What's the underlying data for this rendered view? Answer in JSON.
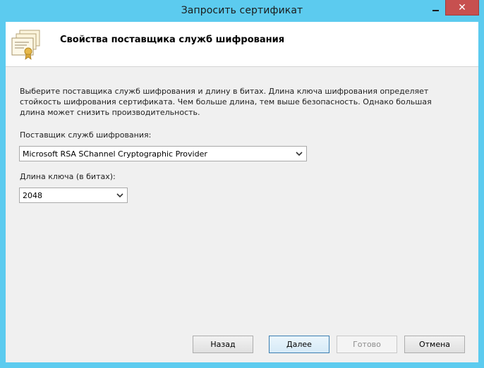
{
  "window": {
    "title": "Запросить сертификат"
  },
  "header": {
    "title": "Свойства поставщика служб шифрования",
    "icon": "certificate-icon"
  },
  "content": {
    "description": "Выберите поставщика служб шифрования и длину в битах. Длина ключа шифрования определяет стойкость шифрования сертификата. Чем больше длина, тем выше безопасность. Однако большая длина может снизить производительность.",
    "provider_label": "Поставщик служб шифрования:",
    "provider_value": "Microsoft RSA SChannel Cryptographic Provider",
    "key_length_label": "Длина ключа (в битах):",
    "key_length_value": "2048"
  },
  "buttons": {
    "back": "Назад",
    "next": "Далее",
    "finish": "Готово",
    "cancel": "Отмена"
  },
  "colors": {
    "frame": "#5ccbef",
    "close_button": "#c7504f",
    "default_button_border": "#3c7fb1"
  }
}
